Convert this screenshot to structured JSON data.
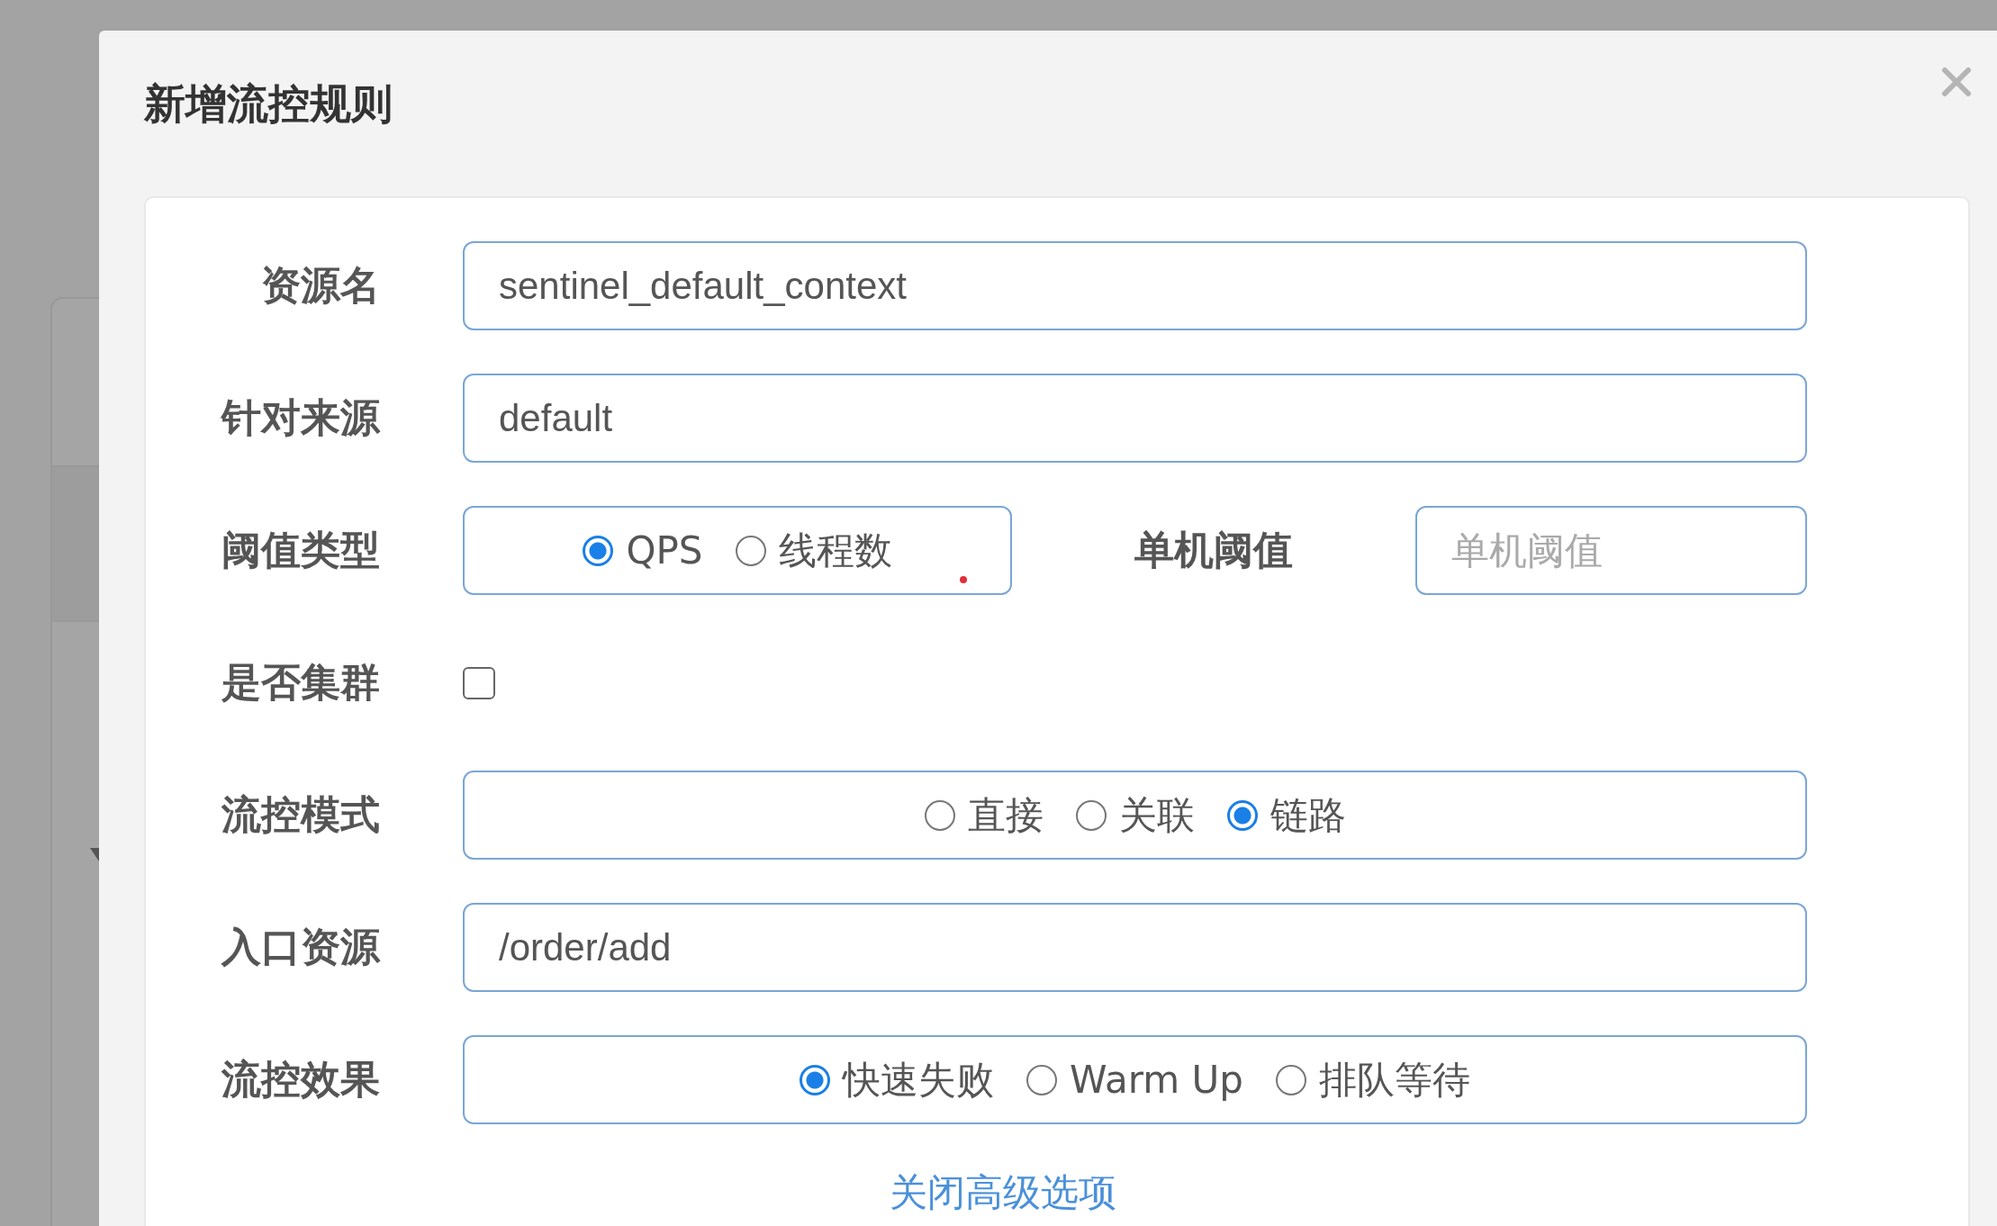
{
  "dialog": {
    "title": "新增流控规则"
  },
  "rows": [
    {
      "kind": "text",
      "label": "资源名",
      "value": "sentinel_default_context"
    },
    {
      "kind": "text",
      "label": "针对来源",
      "value": "default"
    },
    {
      "kind": "threshold",
      "label": "阈值类型",
      "options": [
        {
          "label": "QPS",
          "selected": true
        },
        {
          "label": "线程数",
          "selected": false
        }
      ],
      "side_label": "单机阈值",
      "side_placeholder": "单机阈值"
    },
    {
      "kind": "checkbox",
      "label": "是否集群",
      "checked": false
    },
    {
      "kind": "radio",
      "label": "流控模式",
      "options": [
        {
          "label": "直接",
          "selected": false
        },
        {
          "label": "关联",
          "selected": false
        },
        {
          "label": "链路",
          "selected": true
        }
      ]
    },
    {
      "kind": "text",
      "label": "入口资源",
      "value": "/order/add"
    },
    {
      "kind": "radio",
      "label": "流控效果",
      "options": [
        {
          "label": "快速失败",
          "selected": true
        },
        {
          "label": "Warm Up",
          "selected": false
        },
        {
          "label": "排队等待",
          "selected": false
        }
      ]
    }
  ],
  "advanced_link": "关闭高级选项"
}
